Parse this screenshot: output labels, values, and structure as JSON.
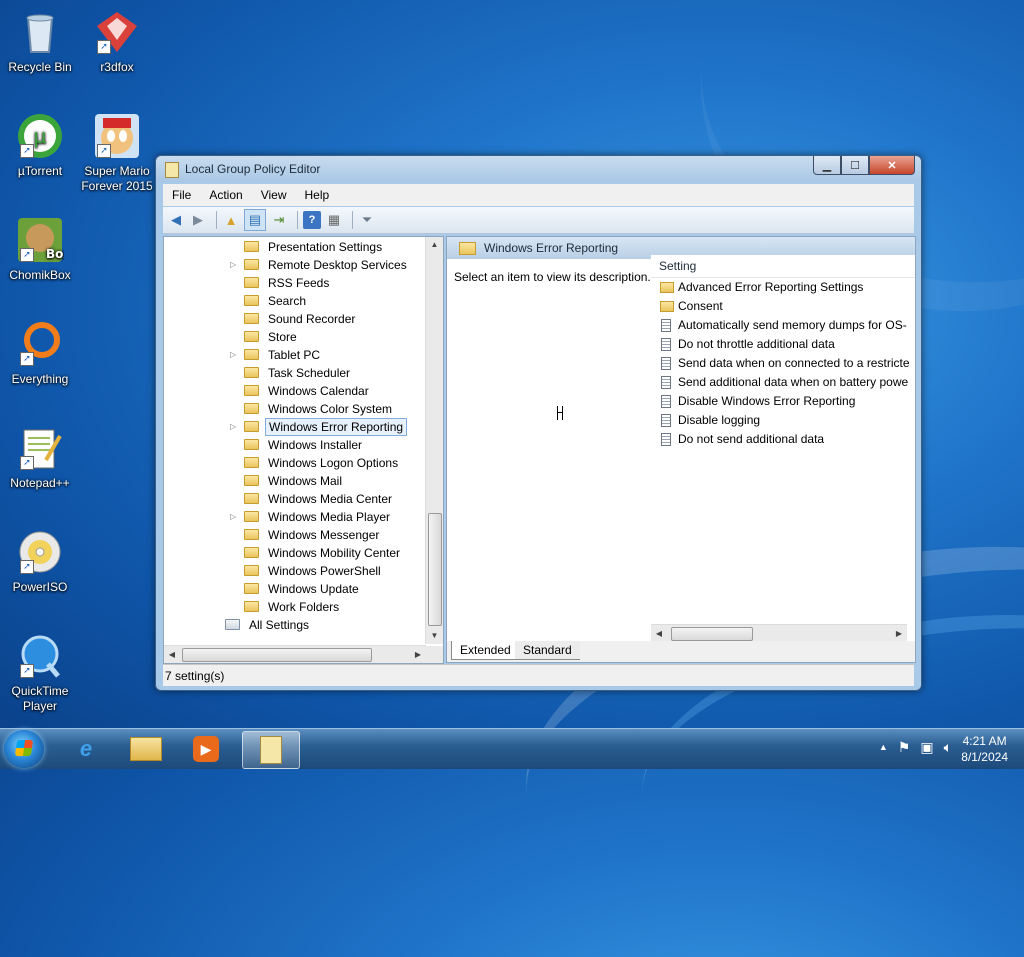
{
  "desktop": {
    "icons": [
      {
        "label": "Recycle Bin"
      },
      {
        "label": "r3dfox"
      },
      {
        "label": "µTorrent"
      },
      {
        "label": "Super Mario Forever 2015"
      },
      {
        "label": "ChomikBox"
      },
      {
        "label": "Everything"
      },
      {
        "label": "Notepad++"
      },
      {
        "label": "PowerISO"
      },
      {
        "label": "QuickTime Player"
      }
    ]
  },
  "window": {
    "title": "Local Group Policy Editor",
    "menu": [
      "File",
      "Action",
      "View",
      "Help"
    ],
    "tree": {
      "items": [
        {
          "label": "Presentation Settings",
          "expandable": false
        },
        {
          "label": "Remote Desktop Services",
          "expandable": true
        },
        {
          "label": "RSS Feeds",
          "expandable": false
        },
        {
          "label": "Search",
          "expandable": false
        },
        {
          "label": "Sound Recorder",
          "expandable": false
        },
        {
          "label": "Store",
          "expandable": false
        },
        {
          "label": "Tablet PC",
          "expandable": true
        },
        {
          "label": "Task Scheduler",
          "expandable": false
        },
        {
          "label": "Windows Calendar",
          "expandable": false
        },
        {
          "label": "Windows Color System",
          "expandable": false
        },
        {
          "label": "Windows Error Reporting",
          "expandable": true,
          "selected": true
        },
        {
          "label": "Windows Installer",
          "expandable": false
        },
        {
          "label": "Windows Logon Options",
          "expandable": false
        },
        {
          "label": "Windows Mail",
          "expandable": false
        },
        {
          "label": "Windows Media Center",
          "expandable": false
        },
        {
          "label": "Windows Media Player",
          "expandable": true
        },
        {
          "label": "Windows Messenger",
          "expandable": false
        },
        {
          "label": "Windows Mobility Center",
          "expandable": false
        },
        {
          "label": "Windows PowerShell",
          "expandable": false
        },
        {
          "label": "Windows Update",
          "expandable": false
        },
        {
          "label": "Work Folders",
          "expandable": false
        }
      ],
      "all_settings": "All Settings"
    },
    "details": {
      "header": "Windows Error Reporting",
      "description": "Select an item to view its description.",
      "column_header": "Setting",
      "items": [
        {
          "label": "Advanced Error Reporting Settings",
          "type": "folder"
        },
        {
          "label": "Consent",
          "type": "folder"
        },
        {
          "label": "Automatically send memory dumps for OS-",
          "type": "setting"
        },
        {
          "label": "Do not throttle additional data",
          "type": "setting"
        },
        {
          "label": "Send data when on connected to a restricte",
          "type": "setting"
        },
        {
          "label": "Send additional data when on battery powe",
          "type": "setting"
        },
        {
          "label": "Disable Windows Error Reporting",
          "type": "setting"
        },
        {
          "label": "Disable logging",
          "type": "setting"
        },
        {
          "label": "Do not send additional data",
          "type": "setting"
        }
      ]
    },
    "tabs": [
      "Extended",
      "Standard"
    ],
    "status": "7 setting(s)"
  },
  "taskbar": {
    "clock_time": "4:21 AM",
    "clock_date": "8/1/2024"
  }
}
